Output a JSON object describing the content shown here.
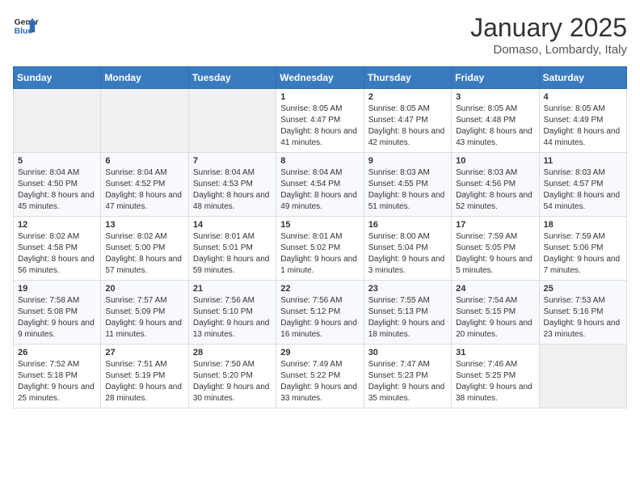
{
  "header": {
    "logo_general": "General",
    "logo_blue": "Blue",
    "month": "January 2025",
    "location": "Domaso, Lombardy, Italy"
  },
  "days_of_week": [
    "Sunday",
    "Monday",
    "Tuesday",
    "Wednesday",
    "Thursday",
    "Friday",
    "Saturday"
  ],
  "weeks": [
    [
      {
        "day": "",
        "info": ""
      },
      {
        "day": "",
        "info": ""
      },
      {
        "day": "",
        "info": ""
      },
      {
        "day": "1",
        "info": "Sunrise: 8:05 AM\nSunset: 4:47 PM\nDaylight: 8 hours and 41 minutes."
      },
      {
        "day": "2",
        "info": "Sunrise: 8:05 AM\nSunset: 4:47 PM\nDaylight: 8 hours and 42 minutes."
      },
      {
        "day": "3",
        "info": "Sunrise: 8:05 AM\nSunset: 4:48 PM\nDaylight: 8 hours and 43 minutes."
      },
      {
        "day": "4",
        "info": "Sunrise: 8:05 AM\nSunset: 4:49 PM\nDaylight: 8 hours and 44 minutes."
      }
    ],
    [
      {
        "day": "5",
        "info": "Sunrise: 8:04 AM\nSunset: 4:50 PM\nDaylight: 8 hours and 45 minutes."
      },
      {
        "day": "6",
        "info": "Sunrise: 8:04 AM\nSunset: 4:52 PM\nDaylight: 8 hours and 47 minutes."
      },
      {
        "day": "7",
        "info": "Sunrise: 8:04 AM\nSunset: 4:53 PM\nDaylight: 8 hours and 48 minutes."
      },
      {
        "day": "8",
        "info": "Sunrise: 8:04 AM\nSunset: 4:54 PM\nDaylight: 8 hours and 49 minutes."
      },
      {
        "day": "9",
        "info": "Sunrise: 8:03 AM\nSunset: 4:55 PM\nDaylight: 8 hours and 51 minutes."
      },
      {
        "day": "10",
        "info": "Sunrise: 8:03 AM\nSunset: 4:56 PM\nDaylight: 8 hours and 52 minutes."
      },
      {
        "day": "11",
        "info": "Sunrise: 8:03 AM\nSunset: 4:57 PM\nDaylight: 8 hours and 54 minutes."
      }
    ],
    [
      {
        "day": "12",
        "info": "Sunrise: 8:02 AM\nSunset: 4:58 PM\nDaylight: 8 hours and 56 minutes."
      },
      {
        "day": "13",
        "info": "Sunrise: 8:02 AM\nSunset: 5:00 PM\nDaylight: 8 hours and 57 minutes."
      },
      {
        "day": "14",
        "info": "Sunrise: 8:01 AM\nSunset: 5:01 PM\nDaylight: 8 hours and 59 minutes."
      },
      {
        "day": "15",
        "info": "Sunrise: 8:01 AM\nSunset: 5:02 PM\nDaylight: 9 hours and 1 minute."
      },
      {
        "day": "16",
        "info": "Sunrise: 8:00 AM\nSunset: 5:04 PM\nDaylight: 9 hours and 3 minutes."
      },
      {
        "day": "17",
        "info": "Sunrise: 7:59 AM\nSunset: 5:05 PM\nDaylight: 9 hours and 5 minutes."
      },
      {
        "day": "18",
        "info": "Sunrise: 7:59 AM\nSunset: 5:06 PM\nDaylight: 9 hours and 7 minutes."
      }
    ],
    [
      {
        "day": "19",
        "info": "Sunrise: 7:58 AM\nSunset: 5:08 PM\nDaylight: 9 hours and 9 minutes."
      },
      {
        "day": "20",
        "info": "Sunrise: 7:57 AM\nSunset: 5:09 PM\nDaylight: 9 hours and 11 minutes."
      },
      {
        "day": "21",
        "info": "Sunrise: 7:56 AM\nSunset: 5:10 PM\nDaylight: 9 hours and 13 minutes."
      },
      {
        "day": "22",
        "info": "Sunrise: 7:56 AM\nSunset: 5:12 PM\nDaylight: 9 hours and 16 minutes."
      },
      {
        "day": "23",
        "info": "Sunrise: 7:55 AM\nSunset: 5:13 PM\nDaylight: 9 hours and 18 minutes."
      },
      {
        "day": "24",
        "info": "Sunrise: 7:54 AM\nSunset: 5:15 PM\nDaylight: 9 hours and 20 minutes."
      },
      {
        "day": "25",
        "info": "Sunrise: 7:53 AM\nSunset: 5:16 PM\nDaylight: 9 hours and 23 minutes."
      }
    ],
    [
      {
        "day": "26",
        "info": "Sunrise: 7:52 AM\nSunset: 5:18 PM\nDaylight: 9 hours and 25 minutes."
      },
      {
        "day": "27",
        "info": "Sunrise: 7:51 AM\nSunset: 5:19 PM\nDaylight: 9 hours and 28 minutes."
      },
      {
        "day": "28",
        "info": "Sunrise: 7:50 AM\nSunset: 5:20 PM\nDaylight: 9 hours and 30 minutes."
      },
      {
        "day": "29",
        "info": "Sunrise: 7:49 AM\nSunset: 5:22 PM\nDaylight: 9 hours and 33 minutes."
      },
      {
        "day": "30",
        "info": "Sunrise: 7:47 AM\nSunset: 5:23 PM\nDaylight: 9 hours and 35 minutes."
      },
      {
        "day": "31",
        "info": "Sunrise: 7:46 AM\nSunset: 5:25 PM\nDaylight: 9 hours and 38 minutes."
      },
      {
        "day": "",
        "info": ""
      }
    ]
  ]
}
